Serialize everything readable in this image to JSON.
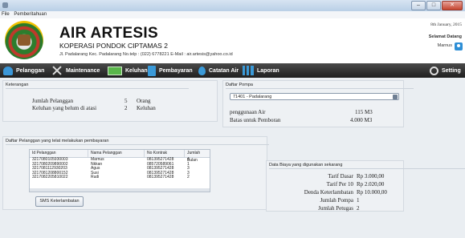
{
  "menu": {
    "file": "File",
    "pemberitahuan": "Pemberitahuan"
  },
  "header": {
    "title": "AIR ARTESIS",
    "subtitle": "KOPERASI PONDOK CIPTAMAS 2",
    "address": "Jl. Padalarang Kec. Padalarang No.telp : (022) 6778221 E-Mail : air.artesis@yahoo.co.id",
    "date": "8th January, 2015",
    "welcome": "Selamat Datang",
    "user": "Marnus"
  },
  "nav": {
    "pelanggan": "Pelanggan",
    "maintenance": "Maintenance",
    "keluhan": "Keluhan",
    "pembayaran": "Pembayaran",
    "catatan_air": "Catatan Air",
    "laporan": "Laporan",
    "setting": "Setting"
  },
  "keterangan": {
    "title": "Keterangan",
    "rows": [
      {
        "label": "Jumlah Pelanggan",
        "value": "5",
        "unit": "Orang"
      },
      {
        "label": "Keluhan yang belum di atasi",
        "value": "2",
        "unit": "Keluhan"
      }
    ]
  },
  "pompa": {
    "title": "Daftar Pompa",
    "selected": "71401 - Padalarang",
    "rows": [
      {
        "label": "penggunaan Air",
        "value": "115 M3"
      },
      {
        "label": "Batas untuk Pemboran",
        "value": "4.000 M3"
      }
    ]
  },
  "telat": {
    "title": "Daftar Pelanggan yang telat melakukan pembayaran",
    "columns": [
      "Id Pelanggan",
      "Nama Pelanggan",
      "No Kontrak",
      "Jumlah Bulan"
    ],
    "rows": [
      [
        "3217080105930003",
        "Marnus",
        "081395271428",
        "4"
      ],
      [
        "3217080209890002",
        "Nkkan",
        "085720589061",
        "1"
      ],
      [
        "3217081112930203",
        "Agus",
        "081395271428",
        "3"
      ],
      [
        "3217081208800152",
        "Susi",
        "081395271428",
        "3"
      ],
      [
        "3217082205810022",
        "Rudi",
        "081395271428",
        "2"
      ]
    ],
    "sms_button": "SMS Keterlambatan"
  },
  "biaya": {
    "title": "Data Biaya yang digunakan sekarang",
    "rows": [
      {
        "label": "Tarif Dasar",
        "value": "Rp 3.000,00"
      },
      {
        "label": "Tarif Per 10",
        "value": "Rp 2.020,00"
      },
      {
        "label": "Denda Keterlambatan",
        "value": "Rp 10.000,00"
      },
      {
        "label": "Jumlah Pompa",
        "value": "1"
      },
      {
        "label": "Jumlah Petugas",
        "value": "2"
      }
    ]
  }
}
